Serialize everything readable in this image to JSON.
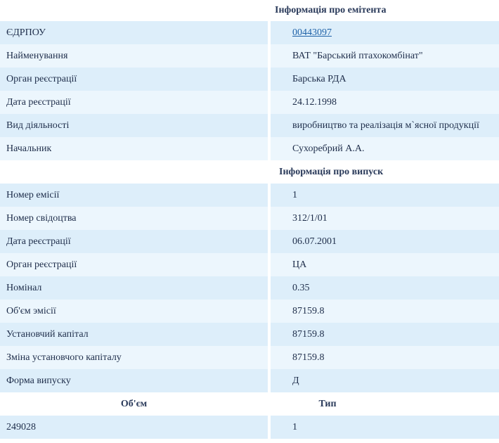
{
  "emitter": {
    "title": "Інформація про емітента",
    "rows": [
      {
        "label": "ЄДРПОУ",
        "value": "00443097",
        "is_link": true
      },
      {
        "label": "Найменування",
        "value": "ВАТ \"Барський птахокомбінат\""
      },
      {
        "label": "Орган реєстрації",
        "value": "Барська РДА"
      },
      {
        "label": "Дата реєстрації",
        "value": "24.12.1998"
      },
      {
        "label": "Вид діяльності",
        "value": "виробництво та реалізація м`ясної продукції"
      },
      {
        "label": "Начальник",
        "value": "Сухоребрий А.А."
      }
    ]
  },
  "issue": {
    "title": "Інформація про випуск",
    "rows": [
      {
        "label": "Номер емісії",
        "value": "1"
      },
      {
        "label": "Номер свідоцтва",
        "value": "312/1/01"
      },
      {
        "label": "Дата реєстрації",
        "value": "06.07.2001"
      },
      {
        "label": "Орган реєстрації",
        "value": "ЦА"
      },
      {
        "label": "Номінал",
        "value": "0.35"
      },
      {
        "label": "Об'єм эмісії",
        "value": "87159.8"
      },
      {
        "label": "Установчий капітал",
        "value": "87159.8"
      },
      {
        "label": "Зміна установчого капіталу",
        "value": "87159.8"
      },
      {
        "label": "Форма випуску",
        "value": "Д"
      }
    ]
  },
  "volume_table": {
    "col1_header": "Об'єм",
    "col2_header": "Тип",
    "rows": [
      {
        "col1": "249028",
        "col2": "1"
      }
    ]
  }
}
